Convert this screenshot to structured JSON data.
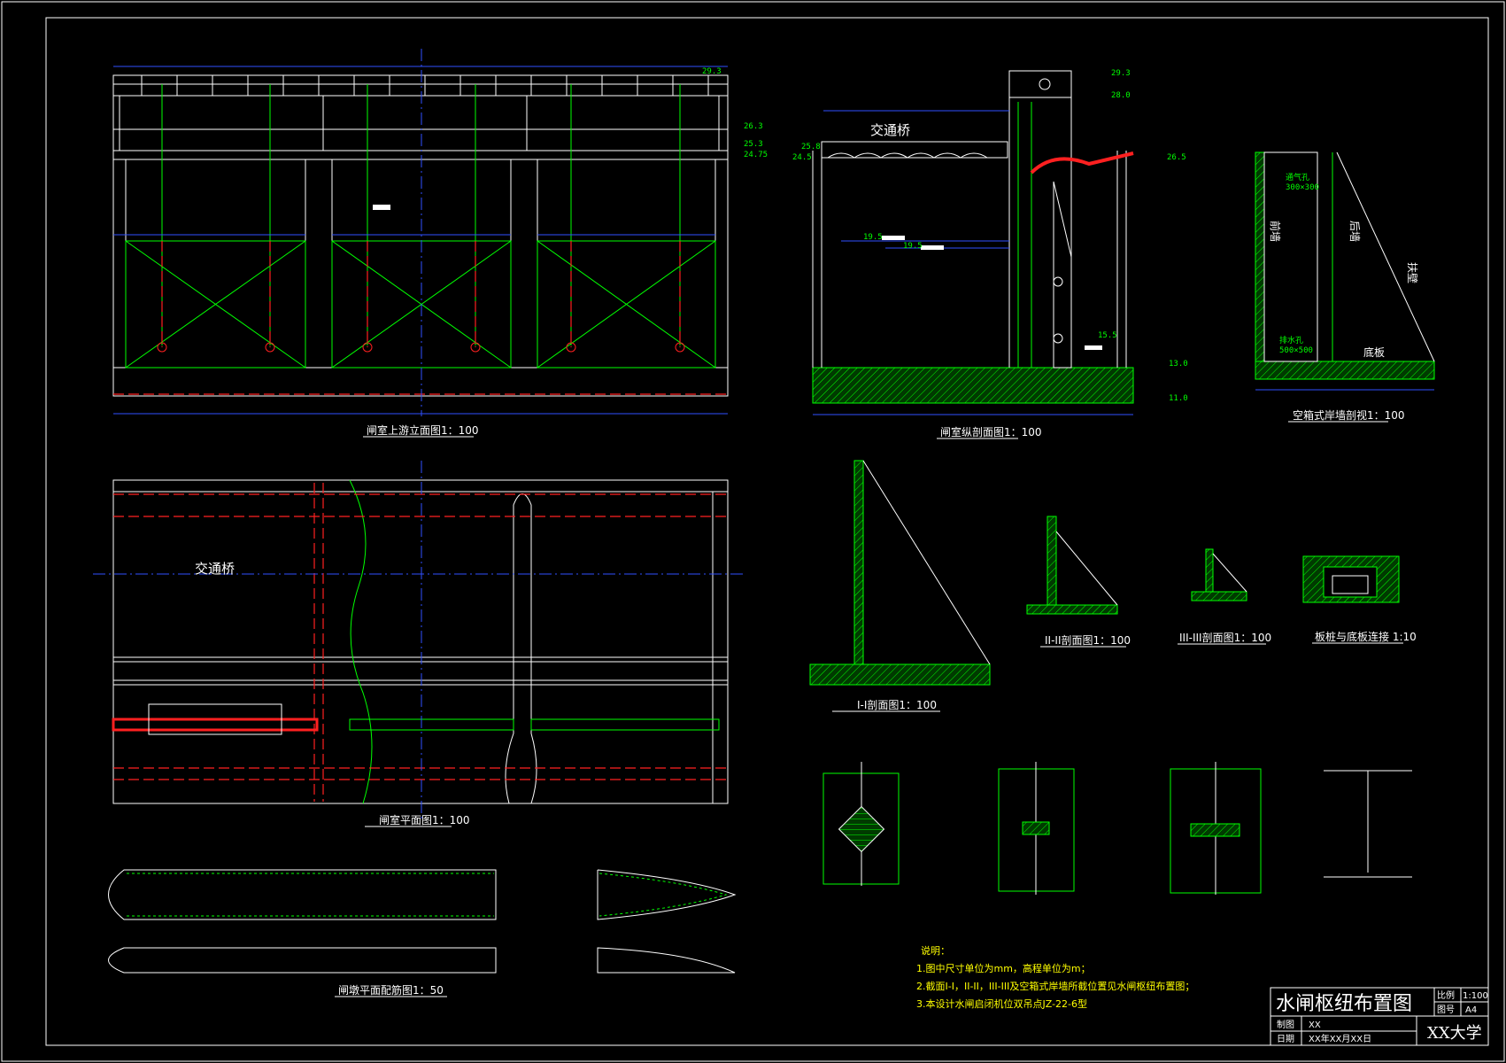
{
  "views": {
    "upstream_elevation": "闸室上游立面图1：100",
    "longitudinal_section": "闸室纵剖面图1：100",
    "retaining_wall_section": "空箱式岸墙剖视1：100",
    "plan": "闸室平面图1：100",
    "section_1": "I-I剖面图1：100",
    "section_2": "II-II剖面图1：100",
    "section_3": "III-III剖面图1：100",
    "pile_joint": "板桩与底板连接 1:10",
    "pier_plan": "闸墩平面配筋图1：50"
  },
  "labels": {
    "traffic_bridge_section": "交通桥",
    "traffic_bridge_plan": "交通桥",
    "front_wall": "前墙",
    "back_wall": "后墙",
    "wing_wall": "扶壁",
    "bottom_slab": "底板",
    "vent_hole": "通气孔",
    "vent_size": "300×300",
    "drain_hole": "排水孔",
    "drain_size": "500×500"
  },
  "elevations": [
    "29.3",
    "26.3",
    "25.3",
    "24.75",
    "29.3",
    "28.0",
    "26.5",
    "25.8",
    "24.5",
    "19.5",
    "19.5",
    "15.5",
    "13.0",
    "11.0"
  ],
  "notes": {
    "heading": "说明：",
    "items": [
      "1.图中尺寸单位为mm，高程单位为m；",
      "2.截面I-I，II-II，III-III及空箱式岸墙所截位置见水闸枢纽布置图；",
      "3.本设计水闸启闭机位双吊点JZ-22-6型"
    ]
  },
  "title_block": {
    "title": "水闸枢纽布置图",
    "scale_label": "比例",
    "scale_value": "1:100",
    "sheet_label": "图号",
    "sheet_value": "A4",
    "drawn_label": "制图",
    "drawn_value": "XX",
    "date_label": "日期",
    "date_value": "XX年XX月XX日",
    "school": "XX大学"
  }
}
